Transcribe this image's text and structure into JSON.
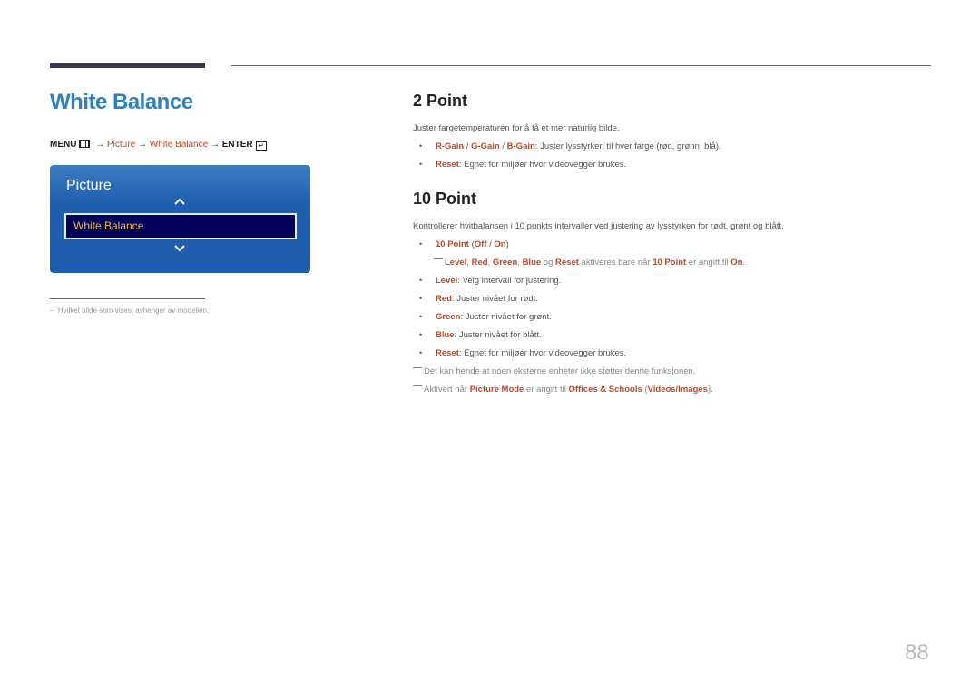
{
  "page": {
    "title": "White Balance",
    "page_number": "88"
  },
  "menu_path": {
    "menu": "MENU",
    "arrow": "→",
    "picture": "Picture",
    "white_balance": "White Balance",
    "enter": "ENTER"
  },
  "osd": {
    "header": "Picture",
    "selected_item": "White Balance",
    "colors": {
      "panel": "#1f5fae",
      "selected_bg": "#00005a",
      "selected_text": "#f0c030"
    }
  },
  "footnote": "Hvilket bilde som vises, avhenger av modellen.",
  "two_point": {
    "heading": "2 Point",
    "intro": "Juster fargetemperaturen for å få et mer naturlig bilde.",
    "bullets": [
      {
        "terms": [
          "R-Gain",
          "G-Gain",
          "B-Gain"
        ],
        "sep": " / ",
        "text": ": Juster lysstyrken til hver farge (rød, grønn, blå)."
      },
      {
        "term": "Reset",
        "text": ": Egnet for miljøer hvor videovegger brukes."
      }
    ]
  },
  "ten_point": {
    "heading": "10 Point",
    "intro": "Kontrollerer hvitbalansen i 10 punkts intervaller ved justering av lysstyrken for rødt, grønt og blått.",
    "toggle": {
      "term": "10 Point",
      "off": "Off",
      "on": "On"
    },
    "toggle_note": {
      "terms": [
        "Level",
        "Red",
        "Green",
        "Blue",
        "Reset"
      ],
      "og": " og ",
      "mid": " aktiveres bare når ",
      "term2": "10 Point",
      "mid2": " er angitt til ",
      "term3": "On",
      "end": "."
    },
    "bullets": [
      {
        "term": "Level",
        "text": ": Velg intervall for justering."
      },
      {
        "term": "Red",
        "text": ": Juster nivået for rødt."
      },
      {
        "term": "Green",
        "text": ": Juster nivået for grønt."
      },
      {
        "term": "Blue",
        "text": ": Juster nivået for blått."
      },
      {
        "term": "Reset",
        "text": ": Egnet for miljøer hvor videovegger brukes."
      }
    ],
    "notes": [
      {
        "text": "Det kan hende at noen eksterne enheter ikke støtter denne funksjonen."
      },
      {
        "pre": "Aktivert når ",
        "term1": "Picture Mode",
        "mid": " er angitt til ",
        "term2": "Offices & Schools",
        "paren_open": " (",
        "term3": "Videos/Images",
        "paren_close": ")."
      }
    ]
  },
  "colors": {
    "title_blue": "#2c80c4",
    "highlight": "#c8461e"
  }
}
